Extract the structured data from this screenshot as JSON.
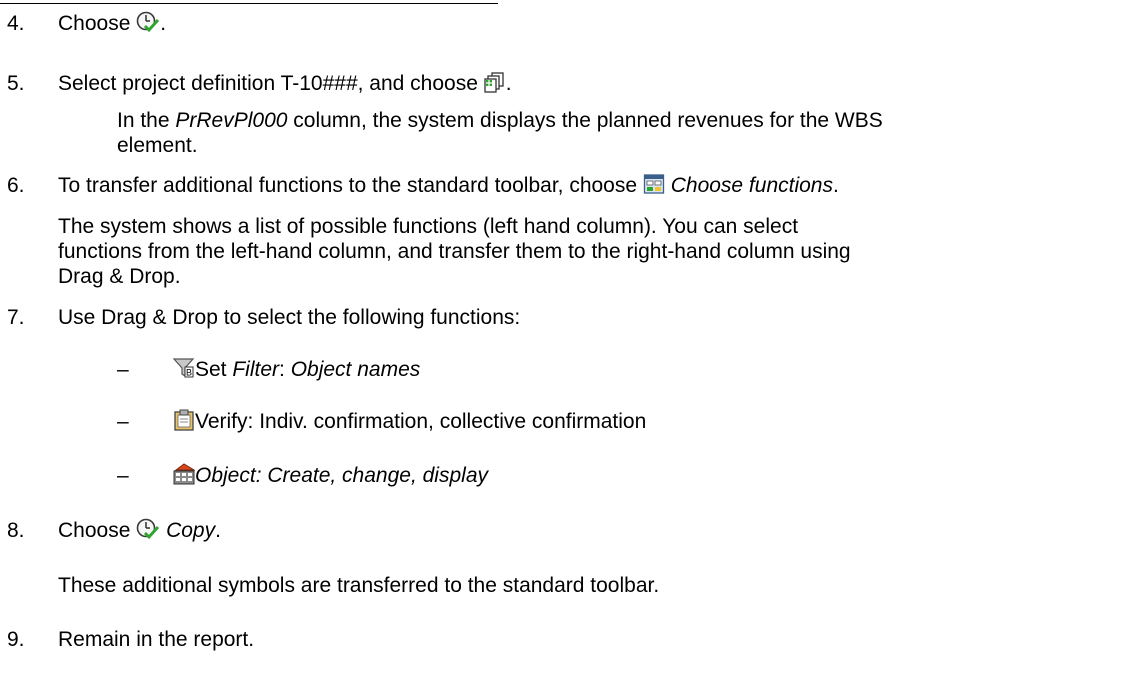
{
  "steps": [
    {
      "number": "4.",
      "text_before": "Choose ",
      "text_after": "."
    },
    {
      "number": "5.",
      "text_before": "Select project definition T-10###, and choose ",
      "text_after": "."
    },
    {
      "number": "6.",
      "text_before": "To transfer additional functions to the standard toolbar, choose ",
      "italic": "Choose functions",
      "text_after": "."
    },
    {
      "number": "7.",
      "text": "Use Drag & Drop to select the following functions:"
    },
    {
      "number": "8.",
      "text_before": "Choose ",
      "italic": "Copy",
      "text_after": "."
    },
    {
      "number": "9.",
      "text": "Remain in the report."
    }
  ],
  "note_5": {
    "italic": "PrRevPl000",
    "line1_rest": " column, the system displays the planned revenues for the WBS",
    "line1_prefix": "In the ",
    "line2": "element."
  },
  "note_6": {
    "line1": "The system shows a list of possible functions (left hand column). You can select",
    "line2": "functions from the left-hand column, and transfer them to the right-hand column using",
    "line3": "Drag & Drop."
  },
  "note_8": "These additional symbols are transferred to the standard toolbar.",
  "functions": [
    {
      "dash": "–",
      "plain": "Set ",
      "italic1": "Filter",
      "plain2": ": ",
      "italic2": "Object names",
      "icon": "filter-icon"
    },
    {
      "dash": "–",
      "plain": "Verify: Indiv. confirmation, collective confirmation",
      "icon": "clipboard-icon"
    },
    {
      "dash": "–",
      "italic": "Object: Create, change, display",
      "icon": "object-create-icon"
    }
  ],
  "icons": {
    "step4": "clock-check-icon",
    "step5": "copy-documents-icon",
    "step6": "choose-functions-icon",
    "step8": "clock-check-icon"
  }
}
